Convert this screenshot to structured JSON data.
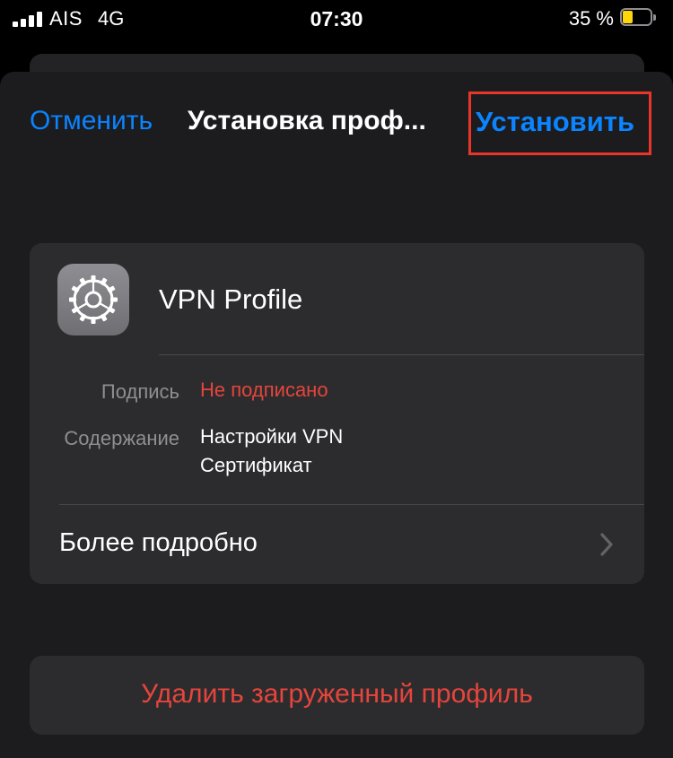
{
  "status_bar": {
    "carrier": "AIS",
    "network": "4G",
    "time": "07:30",
    "battery_percent": "35 %",
    "battery_level": 0.35,
    "battery_color": "#ffd60a"
  },
  "nav": {
    "cancel_label": "Отменить",
    "title": "Установка проф...",
    "install_label": "Установить"
  },
  "profile": {
    "icon": "gear-icon",
    "name": "VPN Profile",
    "signature_label": "Подпись",
    "signature_value": "Не подписано",
    "contents_label": "Содержание",
    "contents_values": [
      "Настройки VPN",
      "Сертификат"
    ],
    "more_details_label": "Более подробно"
  },
  "actions": {
    "delete_label": "Удалить загруженный профиль"
  },
  "colors": {
    "accent": "#0a84ff",
    "destructive": "#e5453c",
    "highlight": "#e8362a",
    "background": "#1c1c1e",
    "card": "#2c2c2e"
  }
}
